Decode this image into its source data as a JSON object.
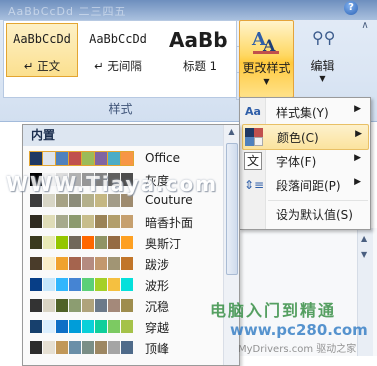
{
  "window": {
    "title": "AaBbCcDd 二三四五"
  },
  "ribbon": {
    "styles_gallery": [
      {
        "sample": "AaBbCcDd",
        "name": "↵ 正文",
        "selected": true
      },
      {
        "sample": "AaBbCcDd",
        "name": "↵ 无间隔",
        "selected": false
      },
      {
        "sample": "AaBb",
        "name": "标题 1",
        "selected": false
      }
    ],
    "group_label": "样式",
    "change_styles_label": "更改样式",
    "edit_label": "编辑",
    "help": "?",
    "collapse": "∧"
  },
  "change_styles_menu": {
    "items": [
      {
        "label": "样式集(Y)",
        "icon": "style-set-icon",
        "submenu": true,
        "highlighted": false
      },
      {
        "label": "颜色(C)",
        "icon": "color-palette-icon",
        "submenu": true,
        "highlighted": true
      },
      {
        "label": "字体(F)",
        "icon": "font-icon",
        "submenu": true,
        "highlighted": false
      },
      {
        "label": "段落间距(P)",
        "icon": "paragraph-spacing-icon",
        "submenu": true,
        "highlighted": false
      },
      {
        "label": "设为默认值(S)",
        "icon": "",
        "submenu": false,
        "highlighted": false
      }
    ]
  },
  "colors_menu": {
    "header": "内置",
    "themes": [
      {
        "name": "Office",
        "selected": true,
        "colors": [
          "#1f3864",
          "#dfe4ec",
          "#4f81bd",
          "#c0504d",
          "#9bbb59",
          "#8064a2",
          "#4bacc6",
          "#f79646"
        ]
      },
      {
        "name": "灰度",
        "selected": false,
        "colors": [
          "#000000",
          "#f2f2f2",
          "#dddddd",
          "#b2b2b2",
          "#969696",
          "#808080",
          "#5f5f5f",
          "#4d4d4d"
        ]
      },
      {
        "name": "Couture",
        "selected": false,
        "colors": [
          "#3c3c3c",
          "#d8d6c6",
          "#a6a285",
          "#8c8c7a",
          "#b4b08b",
          "#c5b782",
          "#a39c88",
          "#9e8b6f"
        ]
      },
      {
        "name": "暗香扑面",
        "selected": false,
        "colors": [
          "#2f2b20",
          "#dfdcb7",
          "#a6a98c",
          "#8c9a6e",
          "#c7bd8b",
          "#9b8357",
          "#b29e6b",
          "#c6a06f"
        ]
      },
      {
        "name": "奥斯汀",
        "selected": false,
        "colors": [
          "#3a3a1e",
          "#e8eab6",
          "#94c600",
          "#71685a",
          "#ff6700",
          "#909465",
          "#956b43",
          "#fea022"
        ]
      },
      {
        "name": "跋涉",
        "selected": false,
        "colors": [
          "#4a3c2a",
          "#fbeec9",
          "#f0a22e",
          "#a5644e",
          "#b58b80",
          "#c3986d",
          "#a19574",
          "#c17529"
        ]
      },
      {
        "name": "波形",
        "selected": false,
        "colors": [
          "#073e87",
          "#c6e7fc",
          "#31b6fd",
          "#4584d3",
          "#5bd078",
          "#a5d028",
          "#f5c040",
          "#05e0db"
        ]
      },
      {
        "name": "沉稳",
        "selected": false,
        "colors": [
          "#333333",
          "#d9d4c4",
          "#4f6228",
          "#8c9d71",
          "#b0a37c",
          "#6c7a8a",
          "#a4897a",
          "#9e8d4e"
        ]
      },
      {
        "name": "穿越",
        "selected": false,
        "colors": [
          "#17406d",
          "#dbefff",
          "#0f6fc6",
          "#009dd9",
          "#0bd0d9",
          "#10cf9b",
          "#7cca62",
          "#a5c249"
        ]
      },
      {
        "name": "顶峰",
        "selected": false,
        "colors": [
          "#2c2c2c",
          "#e6e0d3",
          "#c19859",
          "#6a8fa8",
          "#7a8e86",
          "#9d8762",
          "#a5a5a5",
          "#4f6b8a"
        ]
      }
    ]
  },
  "watermarks": {
    "top": "WWW.Tiaya.com",
    "brand": "电脑入门到精通",
    "url": "www.pc280.com",
    "footer": "MyDrivers.com 驱动之家"
  }
}
